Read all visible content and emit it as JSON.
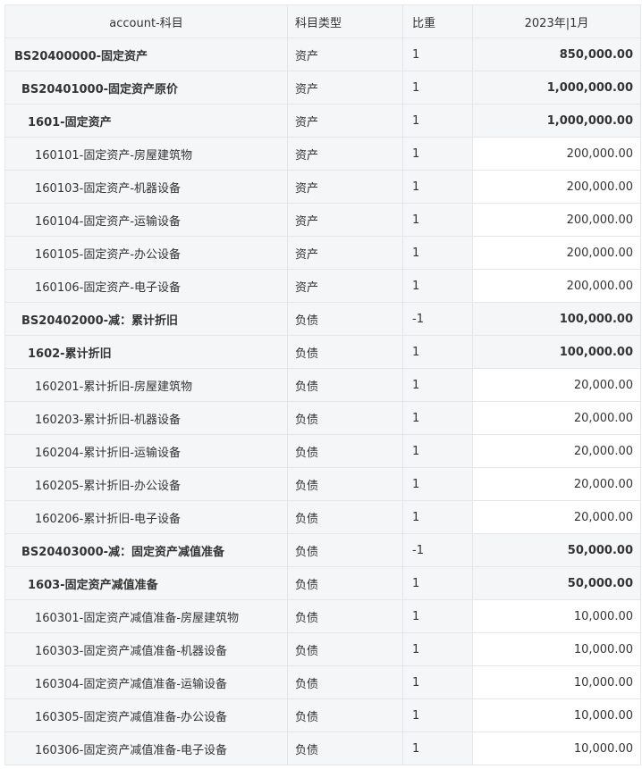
{
  "header": {
    "col_account": "account-科目",
    "col_type": "科目类型",
    "col_weight": "比重",
    "col_period": "2023年|1月"
  },
  "rows": [
    {
      "account": "BS20400000-固定资产",
      "type": "资产",
      "weight": "1",
      "value": "850,000.00",
      "level": 0,
      "group": true
    },
    {
      "account": "BS20401000-固定资产原价",
      "type": "资产",
      "weight": "1",
      "value": "1,000,000.00",
      "level": 1,
      "group": true
    },
    {
      "account": "1601-固定资产",
      "type": "资产",
      "weight": "1",
      "value": "1,000,000.00",
      "level": 2,
      "group": true
    },
    {
      "account": "160101-固定资产-房屋建筑物",
      "type": "资产",
      "weight": "1",
      "value": "200,000.00",
      "level": 3,
      "group": false
    },
    {
      "account": "160103-固定资产-机器设备",
      "type": "资产",
      "weight": "1",
      "value": "200,000.00",
      "level": 3,
      "group": false
    },
    {
      "account": "160104-固定资产-运输设备",
      "type": "资产",
      "weight": "1",
      "value": "200,000.00",
      "level": 3,
      "group": false
    },
    {
      "account": "160105-固定资产-办公设备",
      "type": "资产",
      "weight": "1",
      "value": "200,000.00",
      "level": 3,
      "group": false
    },
    {
      "account": "160106-固定资产-电子设备",
      "type": "资产",
      "weight": "1",
      "value": "200,000.00",
      "level": 3,
      "group": false
    },
    {
      "account": "BS20402000-减：累计折旧",
      "type": "负债",
      "weight": "-1",
      "value": "100,000.00",
      "level": 1,
      "group": true
    },
    {
      "account": "1602-累计折旧",
      "type": "负债",
      "weight": "1",
      "value": "100,000.00",
      "level": 2,
      "group": true
    },
    {
      "account": "160201-累计折旧-房屋建筑物",
      "type": "负债",
      "weight": "1",
      "value": "20,000.00",
      "level": 3,
      "group": false
    },
    {
      "account": "160203-累计折旧-机器设备",
      "type": "负债",
      "weight": "1",
      "value": "20,000.00",
      "level": 3,
      "group": false
    },
    {
      "account": "160204-累计折旧-运输设备",
      "type": "负债",
      "weight": "1",
      "value": "20,000.00",
      "level": 3,
      "group": false
    },
    {
      "account": "160205-累计折旧-办公设备",
      "type": "负债",
      "weight": "1",
      "value": "20,000.00",
      "level": 3,
      "group": false
    },
    {
      "account": "160206-累计折旧-电子设备",
      "type": "负债",
      "weight": "1",
      "value": "20,000.00",
      "level": 3,
      "group": false
    },
    {
      "account": "BS20403000-减：固定资产减值准备",
      "type": "负债",
      "weight": "-1",
      "value": "50,000.00",
      "level": 1,
      "group": true
    },
    {
      "account": "1603-固定资产减值准备",
      "type": "负债",
      "weight": "1",
      "value": "50,000.00",
      "level": 2,
      "group": true
    },
    {
      "account": "160301-固定资产减值准备-房屋建筑物",
      "type": "负债",
      "weight": "1",
      "value": "10,000.00",
      "level": 3,
      "group": false
    },
    {
      "account": "160303-固定资产减值准备-机器设备",
      "type": "负债",
      "weight": "1",
      "value": "10,000.00",
      "level": 3,
      "group": false
    },
    {
      "account": "160304-固定资产减值准备-运输设备",
      "type": "负债",
      "weight": "1",
      "value": "10,000.00",
      "level": 3,
      "group": false
    },
    {
      "account": "160305-固定资产减值准备-办公设备",
      "type": "负债",
      "weight": "1",
      "value": "10,000.00",
      "level": 3,
      "group": false
    },
    {
      "account": "160306-固定资产减值准备-电子设备",
      "type": "负债",
      "weight": "1",
      "value": "10,000.00",
      "level": 3,
      "group": false
    }
  ]
}
